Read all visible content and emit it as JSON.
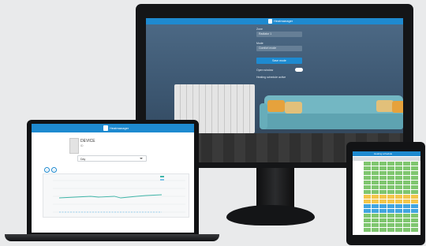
{
  "colors": {
    "brand_blue": "#1e8ad0",
    "grid_green": "#7fc66f",
    "grid_yellow": "#f3c64a",
    "grid_blue": "#42a5e0",
    "sofa": "#73b7c3",
    "pillow_orange": "#e6a23c"
  },
  "monitor": {
    "brand": "Heatmanager",
    "zone_label": "Zone",
    "zone_value": "Radiator 1",
    "mode_label": "Mode",
    "mode_value": "Comfort mode",
    "submit_label": "Save mode",
    "toggle_label": "Open window",
    "footer_note": "Heating schedule active"
  },
  "laptop": {
    "brand": "Heatmanager",
    "device_name": "DEVICE",
    "device_sub": "ID",
    "period_select": "Day"
  },
  "tablet": {
    "title": "Heating schedule"
  }
}
